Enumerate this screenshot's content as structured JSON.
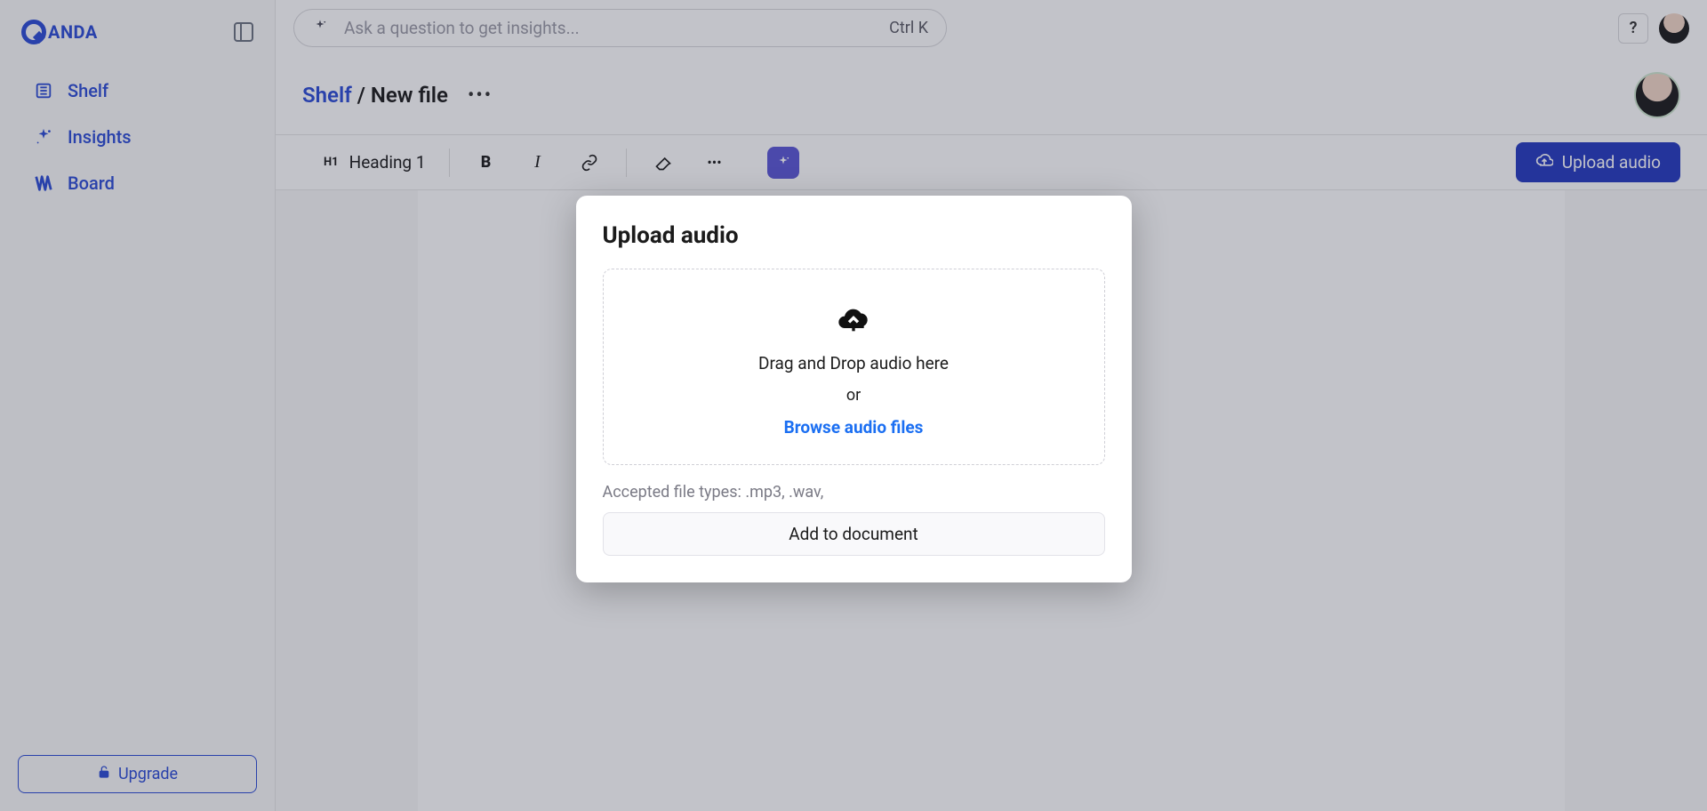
{
  "logo": {
    "text": "ANDA"
  },
  "sidebar": {
    "items": [
      {
        "label": "Shelf"
      },
      {
        "label": "Insights"
      },
      {
        "label": "Board"
      }
    ],
    "upgrade_label": "Upgrade"
  },
  "search": {
    "placeholder": "Ask a question to get insights...",
    "shortcut": "Ctrl K"
  },
  "help_label": "?",
  "breadcrumb": {
    "root": "Shelf",
    "separator": "/",
    "current": "New file"
  },
  "toolbar": {
    "heading_badge": "H1",
    "heading_label": "Heading 1",
    "upload_label": "Upload audio"
  },
  "modal": {
    "title": "Upload audio",
    "drop_text": "Drag and Drop audio here",
    "or_text": "or",
    "browse_text": "Browse audio files",
    "accepted_text": "Accepted file types: .mp3, .wav,",
    "add_button": "Add to document"
  }
}
